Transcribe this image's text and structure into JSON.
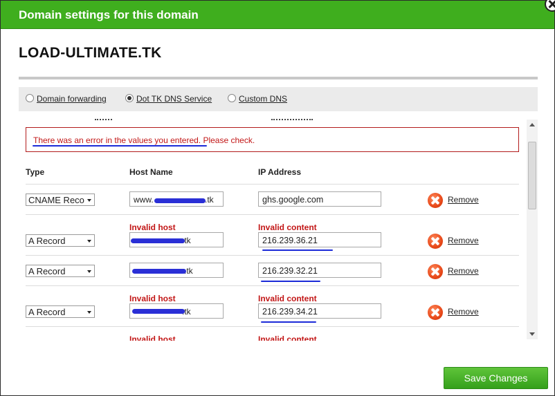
{
  "titlebar": {
    "title": "Domain settings for this domain"
  },
  "domain": {
    "name": "LOAD-ULTIMATE.TK"
  },
  "mode": {
    "options": [
      {
        "label": "Domain forwarding",
        "selected": false
      },
      {
        "label": "Dot TK DNS Service",
        "selected": true
      },
      {
        "label": "Custom DNS",
        "selected": false
      }
    ]
  },
  "error": {
    "message": "There was an error in the values you entered. Please check."
  },
  "table": {
    "headers": {
      "type": "Type",
      "host": "Host Name",
      "ip": "IP Address"
    },
    "rows": [
      {
        "type": "CNAME Record",
        "host": "www.",
        "host_tail": ".tk",
        "ip": "ghs.google.com",
        "host_error": "",
        "ip_error": "",
        "remove": "Remove"
      },
      {
        "type": "A Record",
        "host": "",
        "host_tail": ".tk",
        "ip": "216.239.36.21",
        "host_error": "Invalid host",
        "ip_error": "Invalid content",
        "remove": "Remove"
      },
      {
        "type": "A Record",
        "host": "",
        "host_tail": "s.tk",
        "ip": "216.239.32.21",
        "host_error": "",
        "ip_error": "",
        "remove": "Remove"
      },
      {
        "type": "A Record",
        "host": "",
        "host_tail": ".tk",
        "ip": "216.239.34.21",
        "host_error": "Invalid host",
        "ip_error": "Invalid content",
        "remove": "Remove"
      }
    ],
    "partial_row": {
      "host_error": "Invalid host",
      "ip_error": "Invalid content"
    }
  },
  "actions": {
    "save_label": "Save Changes"
  },
  "colors": {
    "brand_green": "#3fae1e",
    "error_red": "#c21616",
    "remove_orange": "#e8491a"
  }
}
